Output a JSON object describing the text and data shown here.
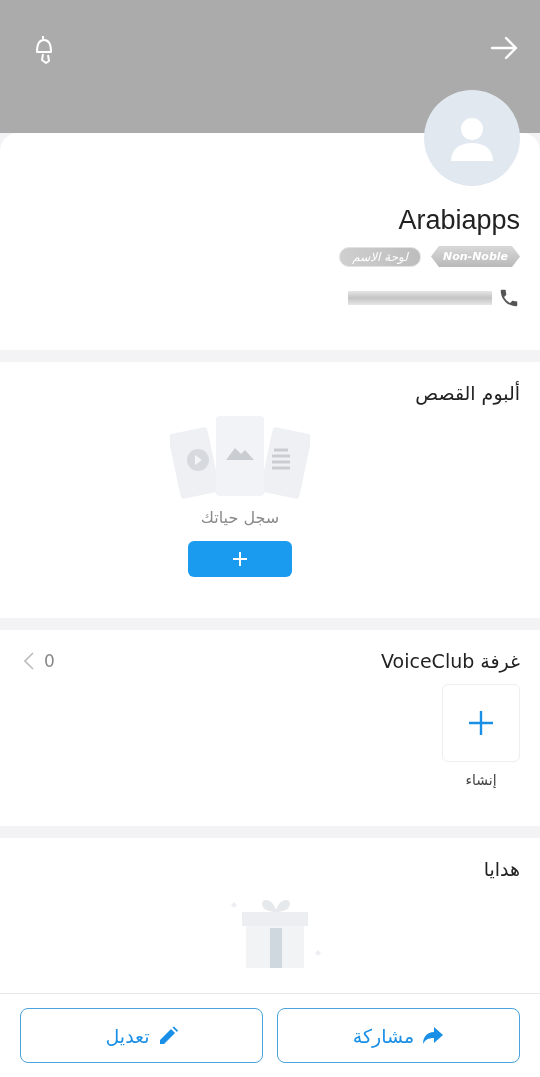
{
  "profile": {
    "name": "Arabiapps",
    "badges": [
      {
        "label": "Non-Noble",
        "kind": "rank"
      },
      {
        "label": "لوحة الاسم",
        "kind": "nameplate"
      }
    ]
  },
  "story_album": {
    "title": "ألبوم القصص",
    "empty_text": "سجل حياتك"
  },
  "voice_club": {
    "title": "غرفة VoiceClub",
    "count": "0",
    "create_label": "إنشاء"
  },
  "gifts": {
    "title": "هدايا"
  },
  "actions": [
    {
      "label": "مشاركة",
      "kind": "share"
    },
    {
      "label": "تعديل",
      "kind": "edit"
    }
  ]
}
